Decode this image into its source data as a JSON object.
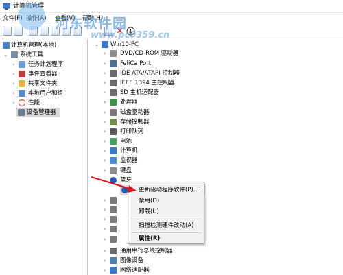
{
  "window": {
    "title": "计算机管理"
  },
  "menu": {
    "items": [
      "文件(F)",
      "操作(A)",
      "查看(V)",
      "帮助(H)"
    ]
  },
  "watermark": {
    "line1": "河东软件园",
    "line2": "www.pc0359.cn"
  },
  "left_tree": {
    "root": "计算机管理(本地)",
    "group": "系统工具",
    "items": [
      "任务计划程序",
      "事件查看器",
      "共享文件夹",
      "本地用户和组",
      "性能",
      "设备管理器"
    ]
  },
  "device_tree": {
    "root": "Win10-PC",
    "items": [
      "DVD/CD-ROM 驱动器",
      "FeliCa Port",
      "IDE ATA/ATAPI 控制器",
      "IEEE 1394 主控制器",
      "SD 主机适配器",
      "处理器",
      "磁盘驱动器",
      "存储控制器",
      "打印队列",
      "电池",
      "计算机",
      "监视器",
      "键盘",
      "蓝牙"
    ],
    "bottom_items": [
      "通用串行总线控制器",
      "图像设备",
      "网络适配器"
    ]
  },
  "context_menu": {
    "items": [
      "更新驱动程序软件(P)...",
      "禁用(D)",
      "卸载(U)",
      "扫描检测硬件改动(A)",
      "属性(R)"
    ]
  },
  "colors": {
    "arrow": "#e0141e",
    "selection": "#d9d9d9",
    "menu_bg": "#f2f2f2"
  }
}
